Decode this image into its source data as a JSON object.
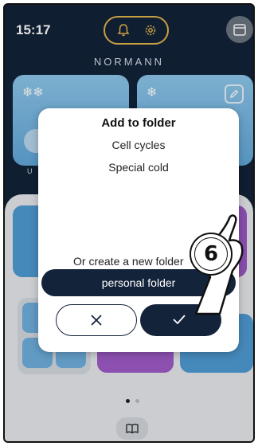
{
  "status": {
    "time": "15:17"
  },
  "header": {
    "brand": "NORMANN"
  },
  "tiles": {
    "left_sub": "U"
  },
  "modal": {
    "title": "Add to folder",
    "folders": [
      "Cell cycles",
      "Special cold"
    ],
    "create_label": "Or create a new folder",
    "new_folder_value": "personal folder"
  },
  "callout": {
    "step": "6"
  },
  "icons": {
    "bell": "bell-icon",
    "gear": "gear-icon",
    "calendar": "calendar-icon",
    "edit": "pencil-icon",
    "close": "close-icon",
    "check": "check-icon",
    "book": "book-icon",
    "hand": "pointing-hand-icon"
  },
  "colors": {
    "navy": "#13233a",
    "accent_gold": "#e3b64a",
    "tile_blue": "#62a8da",
    "tile_purple": "#9b59c4"
  }
}
